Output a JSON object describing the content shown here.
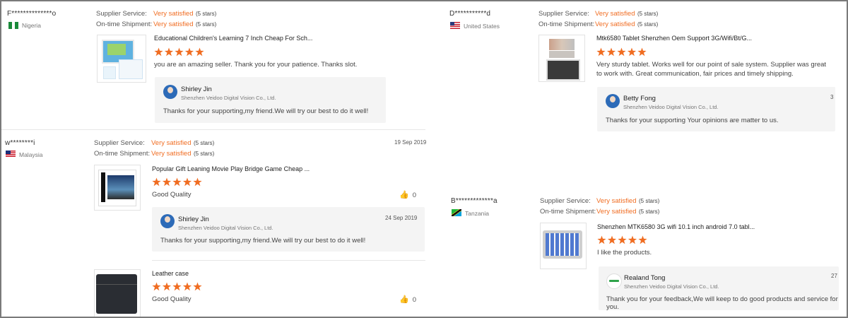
{
  "labels": {
    "supplier_service": "Supplier Service:",
    "ontime_shipment": "On-time Shipment:"
  },
  "reviews": [
    {
      "reviewer": "F**************o",
      "country": "Nigeria",
      "supplier_value": "Very satisfied",
      "supplier_stars": "(5 stars)",
      "shipment_value": "Very satisfied",
      "shipment_stars": "(5 stars)",
      "product_title": "Educational Children's Learning 7 Inch Cheap For Sch...",
      "rating": 5,
      "comment": "you are an amazing seller. Thank you for your patience. Thanks slot.",
      "reply": {
        "name": "Shirley Jin",
        "company": "Shenzhen Veidoo Digital Vision Co., Ltd.",
        "text": "Thanks for your supporting,my friend.We will try our best to do it well!"
      }
    },
    {
      "reviewer": "w********i",
      "country": "Malaysia",
      "date": "19 Sep 2019",
      "supplier_value": "Very satisfied",
      "supplier_stars": "(5 stars)",
      "shipment_value": "Very satisfied",
      "shipment_stars": "(5 stars)",
      "product_title": "Popular Gift Leaning Movie Play Bridge Game Cheap ...",
      "rating": 5,
      "comment": "Good Quality",
      "likes": "0",
      "reply": {
        "name": "Shirley Jin",
        "company": "Shenzhen Veidoo Digital Vision Co., Ltd.",
        "date": "24 Sep 2019",
        "text": "Thanks for your supporting,my friend.We will try our best to do it well!"
      }
    },
    {
      "product_title": "Leather case",
      "rating": 5,
      "comment": "Good Quality",
      "likes": "0"
    },
    {
      "reviewer": "D***********d",
      "country": "United States",
      "supplier_value": "Very satisfied",
      "supplier_stars": "(5 stars)",
      "shipment_value": "Very satisfied",
      "shipment_stars": "(5 stars)",
      "product_title": "Mtk6580 Tablet Shenzhen Oem Support 3G/Wifi/Bt/G...",
      "rating": 5,
      "comment_line1": "Very sturdy tablet.  Works well for our point of sale system.  Supplier was great",
      "comment_line2": "to work with.  Great communication, fair prices and timely shipping.",
      "reply": {
        "name": "Betty Fong",
        "company": "Shenzhen Veidoo Digital Vision Co., Ltd.",
        "date": "3",
        "text": "Thanks for your supporting Your opinions are matter to us."
      }
    },
    {
      "reviewer": "B*************a",
      "country": "Tanzania",
      "supplier_value": "Very satisfied",
      "supplier_stars": "(5 stars)",
      "shipment_value": "Very satisfied",
      "shipment_stars": "(5 stars)",
      "product_title": "Shenzhen MTK6580 3G wifi 10.1 inch android 7.0 tabl...",
      "rating": 5,
      "comment": "I like the products.",
      "reply": {
        "name": "Realand Tong",
        "company": "Shenzhen Veidoo Digital Vision Co., Ltd.",
        "date": "27",
        "text": "Thank you for your feedback,We will keep to do good products and service for you."
      }
    }
  ],
  "colors": {
    "accent": "#f06d22",
    "reply_bg": "#f4f4f4"
  }
}
